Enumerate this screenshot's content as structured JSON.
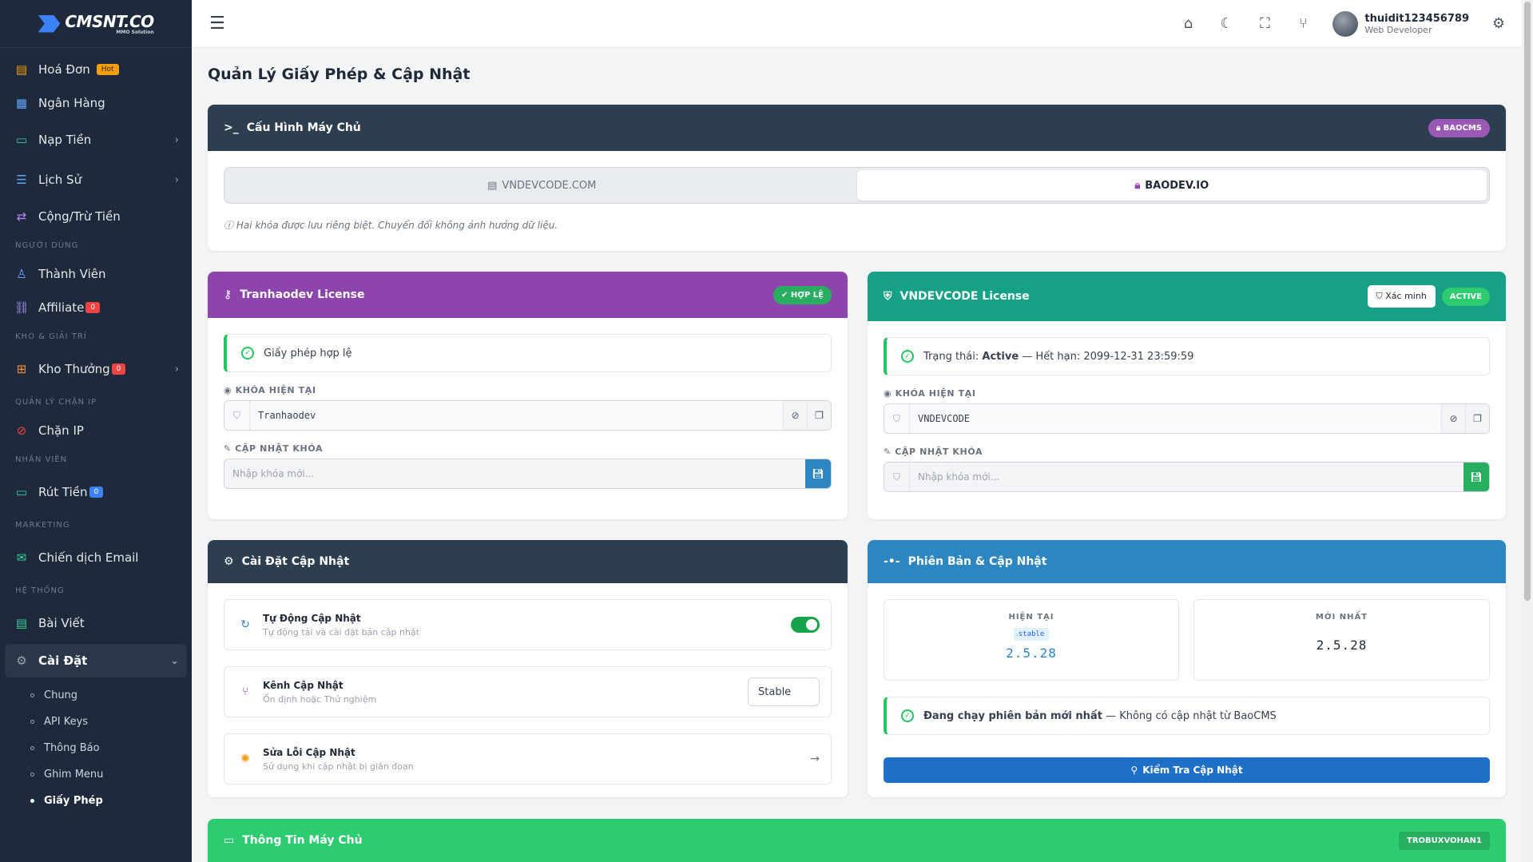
{
  "app": {
    "logo_text": "CMSNT.CO",
    "logo_sub": "MMO Solution"
  },
  "sidebar": {
    "items_top": [
      {
        "label": "Hoá Đơn",
        "icon": "invoice-icon",
        "badge": "Hot"
      },
      {
        "label": "Ngân Hàng",
        "icon": "bank-icon"
      },
      {
        "label": "Nạp Tiền",
        "icon": "wallet-icon",
        "chevron": "›"
      },
      {
        "label": "Lịch Sử",
        "icon": "list-icon",
        "chevron": "›"
      },
      {
        "label": "Cộng/Trừ Tiền",
        "icon": "swap-icon"
      }
    ],
    "section_users": "NGƯỜI DÙNG",
    "members": "Thành Viên",
    "affiliate": "Affiliate",
    "affiliate_badge": "0",
    "section_rewards": "KHO & GIẢI TRÍ",
    "rewards": "Kho Thưởng",
    "rewards_badge": "0",
    "section_ip": "QUẢN LÝ CHẶN IP",
    "block_ip": "Chặn IP",
    "section_staff": "NHÂN VIÊN",
    "withdraw": "Rút Tiền",
    "withdraw_badge": "0",
    "section_marketing": "MARKETING",
    "email_campaign": "Chiến dịch Email",
    "section_system": "HỆ THỐNG",
    "posts": "Bài Viết",
    "settings": "Cài Đặt",
    "settings_sub": [
      "Chung",
      "API Keys",
      "Thông Báo",
      "Ghim Menu",
      "Giấy Phép"
    ]
  },
  "topbar": {
    "username": "thuidit123456789",
    "role": "Web Developer"
  },
  "page": {
    "title": "Quản Lý Giấy Phép & Cập Nhật"
  },
  "server_config": {
    "title": "Cấu Hình Máy Chủ",
    "pill": "BAOCMS",
    "tab_1": "VNDEVCODE.COM",
    "tab_2": "BAODEV.IO",
    "hint": "Hai khóa được lưu riêng biệt. Chuyển đổi không ảnh hưởng dữ liệu."
  },
  "license_left": {
    "title": "Tranhaodev License",
    "pill": "HỢP LỆ",
    "alert": "Giấy phép hợp lệ",
    "current_key_label": "KHÓA HIỆN TẠI",
    "current_key": "Tranhaodev",
    "update_key_label": "CẬP NHẬT KHÓA",
    "placeholder": "Nhập khóa mới..."
  },
  "license_right": {
    "title": "VNDEVCODE License",
    "verify_btn": "Xác minh",
    "pill": "ACTIVE",
    "alert_prefix": "Trạng thái:",
    "alert_status": "Active",
    "alert_suffix": "— Hết hạn: 2099-12-31 23:59:59",
    "current_key_label": "KHÓA HIỆN TẠI",
    "current_key": "VNDEVCODE",
    "update_key_label": "CẬP NHẬT KHÓA",
    "placeholder": "Nhập khóa mới..."
  },
  "update_settings": {
    "title": "Cài Đặt Cập Nhật",
    "auto_title": "Tự Động Cập Nhật",
    "auto_sub": "Tự động tải và cài đặt bản cập nhật",
    "channel_title": "Kênh Cập Nhật",
    "channel_sub": "Ổn định hoặc Thử nghiệm",
    "channel_value": "Stable",
    "fix_title": "Sửa Lỗi Cập Nhật",
    "fix_sub": "Sử dụng khi cập nhật bị gián đoạn"
  },
  "version": {
    "title": "Phiên Bản & Cập Nhật",
    "current_label": "HIỆN TẠI",
    "current_tag": "stable",
    "current_version": "2.5.28",
    "latest_label": "MỚI NHẤT",
    "latest_version": "2.5.28",
    "alert_bold": "Đang chạy phiên bản mới nhất",
    "alert_rest": "— Không có cập nhật từ BaoCMS",
    "check_btn": "Kiểm Tra Cập Nhật"
  },
  "server_info": {
    "title": "Thông Tin Máy Chủ",
    "pill": "TROBUXVOHAN1"
  },
  "colors": {
    "sidebar": "#1e2a3b",
    "purple": "#8e44ad",
    "teal": "#16a085",
    "blue": "#2e86c1",
    "green": "#2ecc71",
    "dark": "#2c3e50"
  }
}
